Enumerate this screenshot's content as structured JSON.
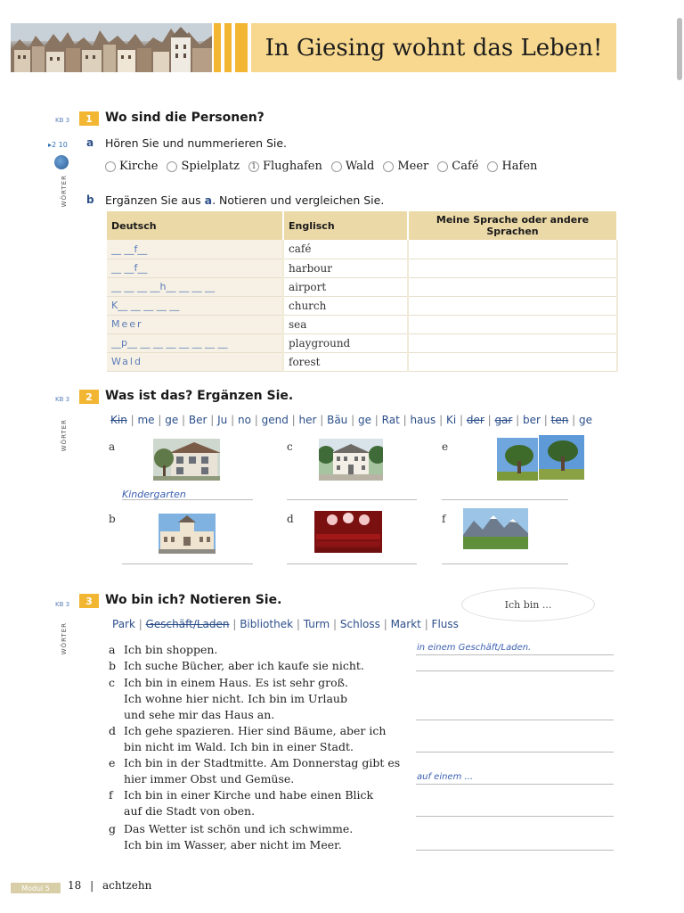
{
  "header": {
    "title": "In Giesing wohnt das Leben!"
  },
  "exercise1": {
    "kb": "KB 3",
    "number": "1",
    "title": "Wo sind die Personen?",
    "side_label": "WÖRTER",
    "track": "▸2 10",
    "a": {
      "letter": "a",
      "instruction": "Hören Sie und nummerieren Sie."
    },
    "options": [
      {
        "mark": "",
        "label": "Kirche"
      },
      {
        "mark": "",
        "label": "Spielplatz"
      },
      {
        "mark": "1",
        "label": "Flughafen"
      },
      {
        "mark": "",
        "label": "Wald"
      },
      {
        "mark": "",
        "label": "Meer"
      },
      {
        "mark": "",
        "label": "Café"
      },
      {
        "mark": "",
        "label": "Hafen"
      }
    ],
    "b": {
      "letter": "b",
      "instruction_pre": "Ergänzen Sie aus ",
      "instruction_ref": "a",
      "instruction_post": ". Notieren und vergleichen Sie."
    },
    "table": {
      "headers": [
        "Deutsch",
        "Englisch",
        "Meine Sprache oder andere Sprachen"
      ],
      "rows": [
        {
          "de": "__ __f__",
          "en": "café"
        },
        {
          "de": "__ __f__",
          "en": "harbour"
        },
        {
          "de": "__ __ __ __h__ __ __ __",
          "en": "airport"
        },
        {
          "de": "K__ __ __ __ __",
          "en": "church"
        },
        {
          "de": "Meer",
          "en": "sea"
        },
        {
          "de": "__p__ __ __ __ __ __ __ __",
          "en": "playground"
        },
        {
          "de": "Wald",
          "en": "forest"
        }
      ]
    }
  },
  "exercise2": {
    "kb": "KB 3",
    "number": "2",
    "title": "Was ist das? Ergänzen Sie.",
    "side_label": "WÖRTER",
    "syllables": [
      {
        "text": "Kin",
        "struck": true
      },
      {
        "text": "me",
        "struck": false
      },
      {
        "text": "ge",
        "struck": false
      },
      {
        "text": "Ber",
        "struck": false
      },
      {
        "text": "Ju",
        "struck": false
      },
      {
        "text": "no",
        "struck": false
      },
      {
        "text": "gend",
        "struck": false
      },
      {
        "text": "her",
        "struck": false
      },
      {
        "text": "Bäu",
        "struck": false
      },
      {
        "text": "ge",
        "struck": false
      },
      {
        "text": "Rat",
        "struck": false
      },
      {
        "text": "haus",
        "struck": false
      },
      {
        "text": "Ki",
        "struck": false
      },
      {
        "text": "der",
        "struck": true
      },
      {
        "text": "gar",
        "struck": true
      },
      {
        "text": "ber",
        "struck": false
      },
      {
        "text": "ten",
        "struck": true
      },
      {
        "text": "ge",
        "struck": false
      }
    ],
    "pictures": [
      {
        "letter": "a",
        "answer": "Kindergarten"
      },
      {
        "letter": "b",
        "answer": ""
      },
      {
        "letter": "c",
        "answer": ""
      },
      {
        "letter": "d",
        "answer": ""
      },
      {
        "letter": "e",
        "answer": ""
      },
      {
        "letter": "f",
        "answer": ""
      }
    ]
  },
  "exercise3": {
    "kb": "KB 3",
    "number": "3",
    "title": "Wo bin ich? Notieren Sie.",
    "side_label": "WÖRTER",
    "speech": "Ich bin ...",
    "words": [
      {
        "text": "Park",
        "struck": false
      },
      {
        "text": "Geschäft/Laden",
        "struck": true
      },
      {
        "text": "Bibliothek",
        "struck": false
      },
      {
        "text": "Turm",
        "struck": false
      },
      {
        "text": "Schloss",
        "struck": false
      },
      {
        "text": "Markt",
        "struck": false
      },
      {
        "text": "Fluss",
        "struck": false
      }
    ],
    "items": [
      {
        "letter": "a",
        "lines": [
          "Ich bin shoppen."
        ],
        "answer": "in einem Geschäft/Laden."
      },
      {
        "letter": "b",
        "lines": [
          "Ich suche Bücher, aber ich kaufe sie nicht."
        ],
        "answer": ""
      },
      {
        "letter": "c",
        "lines": [
          "Ich bin in einem Haus. Es ist sehr groß.",
          "Ich wohne hier nicht. Ich bin im Urlaub",
          "und sehe mir das Haus an."
        ],
        "answer": ""
      },
      {
        "letter": "d",
        "lines": [
          "Ich gehe spazieren. Hier sind Bäume, aber ich",
          "bin nicht im Wald. Ich bin in einer Stadt."
        ],
        "answer": ""
      },
      {
        "letter": "e",
        "lines": [
          "Ich bin in der Stadtmitte. Am Donnerstag gibt es",
          "hier immer Obst und Gemüse."
        ],
        "answer": "auf einem ..."
      },
      {
        "letter": "f",
        "lines": [
          "Ich bin in einer Kirche und habe einen Blick",
          "auf die Stadt von oben."
        ],
        "answer": ""
      },
      {
        "letter": "g",
        "lines": [
          "Das Wetter ist schön und ich schwimme.",
          "Ich bin im Wasser, aber nicht im Meer."
        ],
        "answer": ""
      }
    ]
  },
  "footer": {
    "module": "Modul 5",
    "page_number": "18",
    "separator": "|",
    "page_word": "achtzehn"
  }
}
